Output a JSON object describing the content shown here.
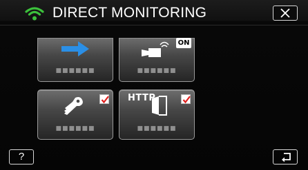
{
  "header": {
    "title": "DIRECT MONITORING",
    "wifi_icon": "wifi-icon",
    "wifi_color": "#3cc23c",
    "close_icon": "close-icon"
  },
  "tiles": [
    {
      "name": "arrow-tile",
      "icon": "arrow-right-icon",
      "label": "■■■■■■",
      "checked": false,
      "icon_color": "#2b8fe6"
    },
    {
      "name": "camera-on-tile",
      "icon": "camera-wifi-on-icon",
      "label": "■■■■■■",
      "badge": "ON",
      "checked": false
    },
    {
      "name": "key-tile",
      "icon": "key-icon",
      "label": "■■■■■■",
      "checked": true
    },
    {
      "name": "http-tile",
      "icon": "http-door-icon",
      "label": "■■■■■■",
      "badge": "HTTP",
      "checked": true
    }
  ],
  "footer": {
    "help_label": "?",
    "back_icon": "back-icon"
  },
  "colors": {
    "check_red": "#e0201e",
    "tile_border": "#9a9a9a"
  }
}
